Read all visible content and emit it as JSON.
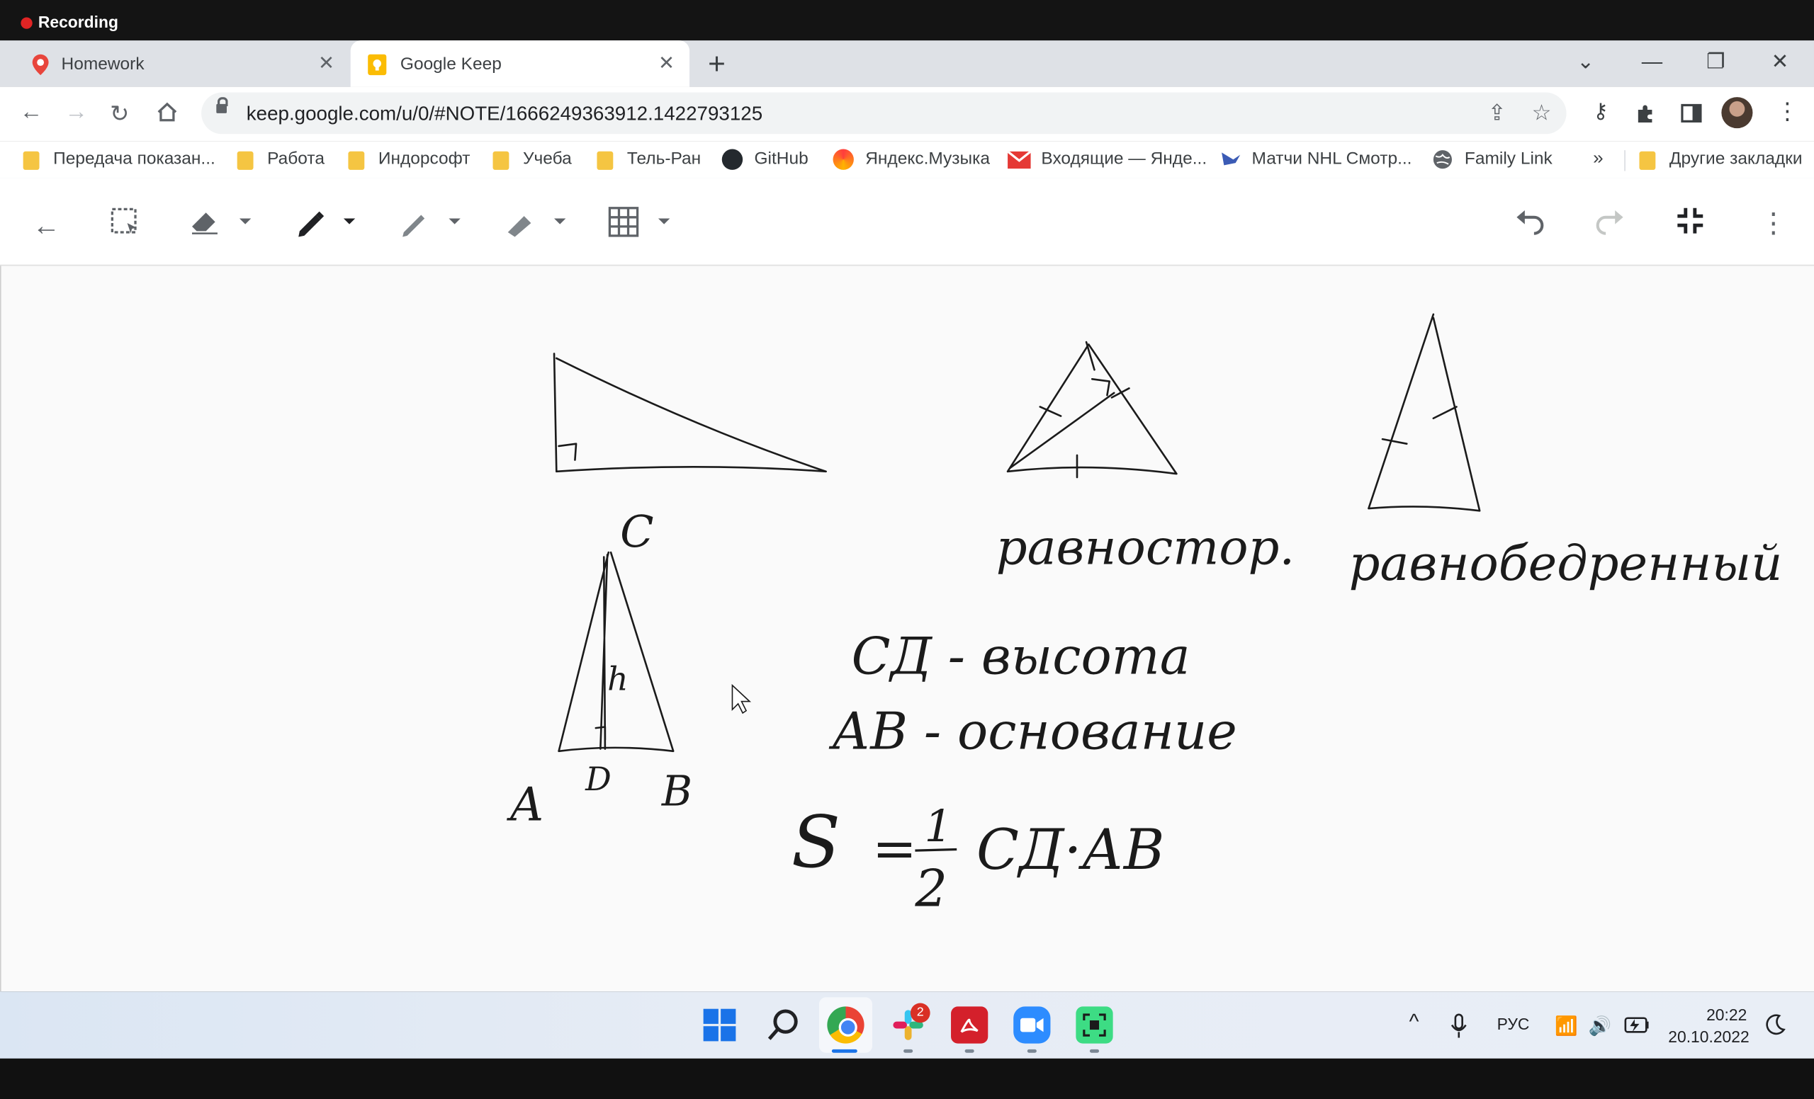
{
  "recording": {
    "label": "Recording",
    "color": "#e02424"
  },
  "tabs": [
    {
      "title": "Homework",
      "icon": "homework-pin-icon",
      "active": false
    },
    {
      "title": "Google Keep",
      "icon": "google-keep-icon",
      "active": true
    }
  ],
  "address": {
    "url": "keep.google.com/u/0/#NOTE/1666249363912.1422793125"
  },
  "bookmarks": [
    {
      "label": "Передача показан...",
      "icon": "folder-icon"
    },
    {
      "label": "Работа",
      "icon": "folder-icon"
    },
    {
      "label": "Индорсофт",
      "icon": "folder-icon"
    },
    {
      "label": "Учеба",
      "icon": "folder-icon"
    },
    {
      "label": "Тель-Ран",
      "icon": "folder-icon"
    },
    {
      "label": "GitHub",
      "icon": "github-icon"
    },
    {
      "label": "Яндекс.Музыка",
      "icon": "yandex-music-icon"
    },
    {
      "label": "Входящие — Янде...",
      "icon": "mail-icon"
    },
    {
      "label": "Матчи NHL Смотр...",
      "icon": "hockey-icon"
    },
    {
      "label": "Family Link",
      "icon": "globe-icon"
    }
  ],
  "bookmarks_more": "»",
  "bookmarks_other": "Другие закладки",
  "drawing_text": {
    "label_c": "C",
    "label_a": "A",
    "label_d": "D",
    "label_b": "B",
    "label_h": "h",
    "equilateral": "равностор.",
    "isosceles": "равнобедренный",
    "height_def": "СД - высота",
    "base_def": "АВ - основание",
    "area_s": "S",
    "area_eq": "=",
    "area_num": "1",
    "area_den": "2",
    "area_rest": "СД·АВ"
  },
  "taskbar": {
    "slack_badge": "2",
    "lang": "РУС",
    "time": "20:22",
    "date": "20.10.2022"
  },
  "colors": {
    "ink": "#1b1b1b",
    "keep_yellow": "#fbbc04",
    "accent": "#1a73e8"
  }
}
